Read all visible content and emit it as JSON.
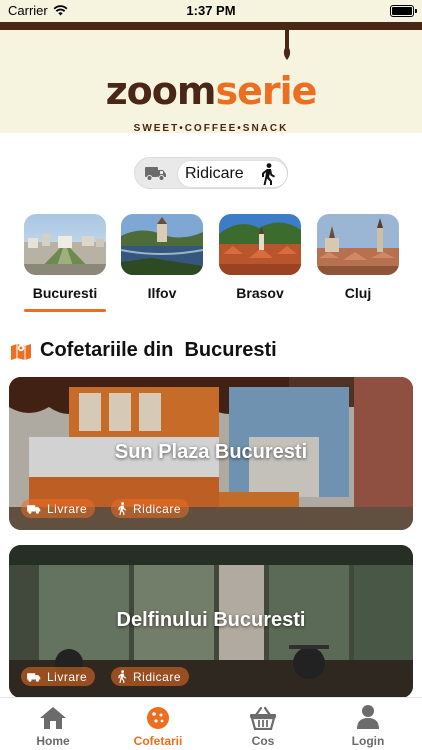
{
  "status": {
    "carrier": "Carrier",
    "time": "1:37 PM"
  },
  "brand": {
    "logo_left": "zoom",
    "logo_right": "serie",
    "tagline": "SWEET•COFFEE•SNACK"
  },
  "mode_toggle": {
    "selected_label": "Ridicare",
    "left_icon": "truck-icon",
    "right_icon": "walking-icon"
  },
  "cities": [
    {
      "name": "Bucuresti",
      "selected": true
    },
    {
      "name": "Ilfov",
      "selected": false
    },
    {
      "name": "Brasov",
      "selected": false
    },
    {
      "name": "Cluj",
      "selected": false
    }
  ],
  "section": {
    "title": "Cofetariile din  Bucuresti",
    "icon": "map-icon"
  },
  "shops": [
    {
      "name": "Sun Plaza Bucuresti",
      "tags": [
        "Livrare",
        "Ridicare"
      ]
    },
    {
      "name": "Delfinului Bucuresti",
      "tags": [
        "Livrare",
        "Ridicare"
      ]
    }
  ],
  "tabbar": [
    {
      "label": "Home",
      "icon": "home-icon",
      "active": false
    },
    {
      "label": "Cofetarii",
      "icon": "cookie-icon",
      "active": true
    },
    {
      "label": "Cos",
      "icon": "basket-icon",
      "active": false
    },
    {
      "label": "Login",
      "icon": "user-icon",
      "active": false
    }
  ],
  "colors": {
    "accent": "#ec6e21",
    "brown": "#4a2616",
    "header_bg": "#f6f3df"
  }
}
